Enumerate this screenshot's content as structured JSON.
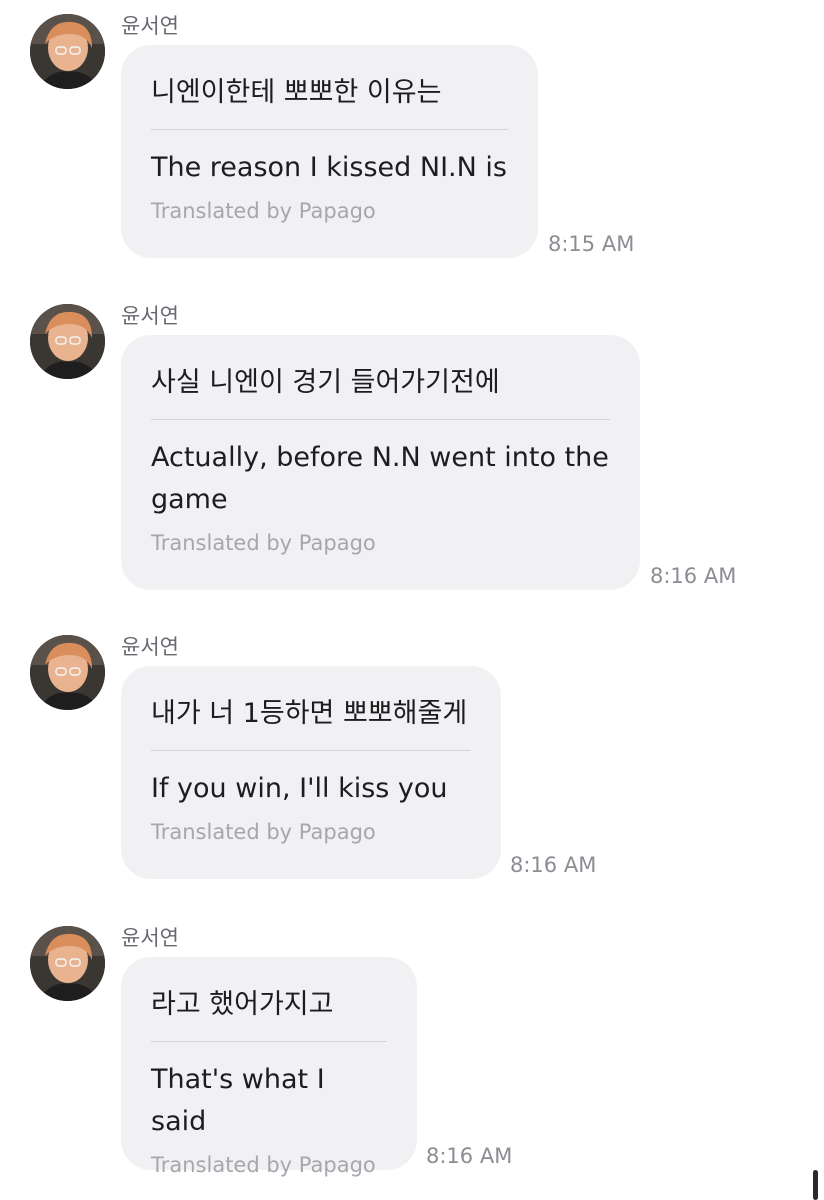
{
  "messages": [
    {
      "sender": "윤서연",
      "original": "니엔이한테 뽀뽀한 이유는",
      "translated": "The reason I kissed NI.N is",
      "credit": "Translated by Papago",
      "time": "8:15 AM"
    },
    {
      "sender": "윤서연",
      "original": "사실 니엔이 경기 들어가기전에",
      "translated": "Actually, before N.N went into the game",
      "credit": "Translated by Papago",
      "time": "8:16 AM"
    },
    {
      "sender": "윤서연",
      "original": "내가 너 1등하면 뽀뽀해줄게",
      "translated": "If you win, I'll kiss you",
      "credit": "Translated by Papago",
      "time": "8:16 AM"
    },
    {
      "sender": "윤서연",
      "original": "라고 했어가지고",
      "translated": "That's what I said",
      "credit": "Translated by Papago",
      "time": "8:16 AM"
    }
  ]
}
